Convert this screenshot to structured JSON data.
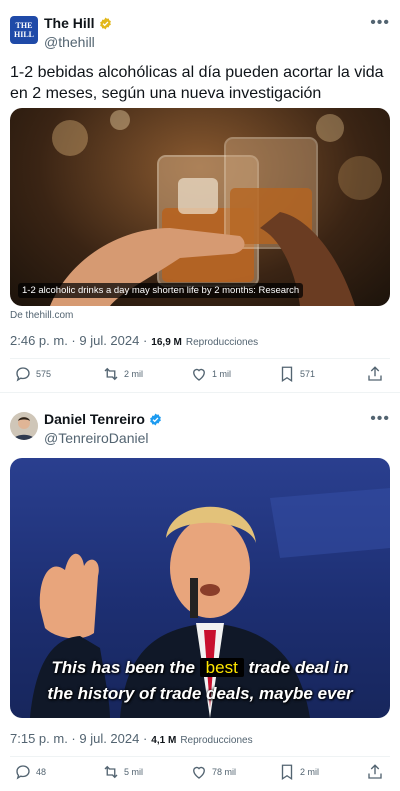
{
  "tweet1": {
    "display_name": "The Hill",
    "handle": "@thehill",
    "avatar_text": "THE HILL",
    "text": "1-2 bebidas alcohólicas al día pueden acortar la vida en 2 meses, según una nueva investigación",
    "media_caption": "1-2 alcoholic drinks a day may shorten life by 2 months: Research",
    "source": "De thehill.com",
    "time": "2:46 p. m. · 9 jul. 2024 ·",
    "views_count": "16,9 M",
    "views_label": "Reproducciones",
    "replies": "575",
    "reposts": "2 mil",
    "likes": "1 mil",
    "bookmarks": "571"
  },
  "tweet2": {
    "display_name": "Daniel Tenreiro",
    "handle": "@TenreiroDaniel",
    "subtitle_line1_before": "This has been the",
    "subtitle_highlight": "best",
    "subtitle_line1_after": "trade deal in",
    "subtitle_line2": "the history of trade deals, maybe ever",
    "time": "7:15 p. m. · 9 jul. 2024 ·",
    "views_count": "4,1 M",
    "views_label": "Reproducciones",
    "replies": "48",
    "reposts": "5 mil",
    "likes": "78 mil",
    "bookmarks": "2 mil"
  },
  "colors": {
    "verified_gold": "#e2b719",
    "verified_blue": "#1d9bf0",
    "secondary_text": "#536471",
    "hill_blue": "#1f4aa8"
  },
  "icons": [
    "more-icon",
    "reply-icon",
    "repost-icon",
    "like-icon",
    "bookmark-icon",
    "share-icon",
    "verified-badge-icon"
  ]
}
